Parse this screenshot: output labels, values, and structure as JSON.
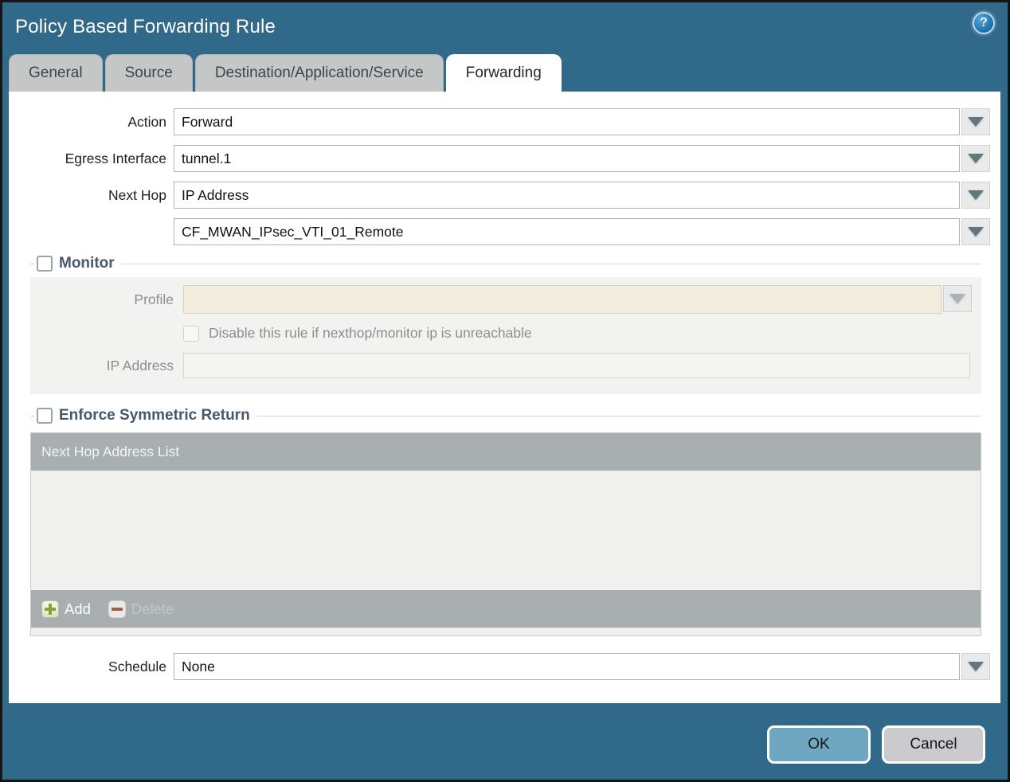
{
  "dialog": {
    "title": "Policy Based Forwarding Rule",
    "help_glyph": "?"
  },
  "tabs": [
    {
      "label": "General",
      "active": false
    },
    {
      "label": "Source",
      "active": false
    },
    {
      "label": "Destination/Application/Service",
      "active": false
    },
    {
      "label": "Forwarding",
      "active": true
    }
  ],
  "form": {
    "action": {
      "label": "Action",
      "value": "Forward"
    },
    "egress_interface": {
      "label": "Egress Interface",
      "value": "tunnel.1"
    },
    "next_hop": {
      "label": "Next Hop",
      "value": "IP Address"
    },
    "next_hop_address": {
      "value": "CF_MWAN_IPsec_VTI_01_Remote"
    },
    "schedule": {
      "label": "Schedule",
      "value": "None"
    }
  },
  "monitor": {
    "legend": "Monitor",
    "checked": false,
    "profile": {
      "label": "Profile",
      "value": ""
    },
    "disable_rule": {
      "label": "Disable this rule if nexthop/monitor ip is unreachable",
      "checked": false
    },
    "ip_address": {
      "label": "IP Address",
      "value": ""
    }
  },
  "symmetric_return": {
    "legend": "Enforce Symmetric Return",
    "checked": false,
    "table": {
      "header": "Next Hop Address List",
      "rows": []
    },
    "add_label": "Add",
    "delete_label": "Delete"
  },
  "footer": {
    "ok_label": "OK",
    "cancel_label": "Cancel"
  },
  "colors": {
    "titlebar_teal": "#31698b",
    "tab_inactive_gray": "#c5c7c7",
    "ok_button_blue": "#6fa7c0",
    "cancel_button_gray": "#cbcbce",
    "profile_field_beige": "#f1ecdc",
    "table_bar_gray": "#a9aeb1",
    "add_icon_green": "#87a23a",
    "delete_icon_red": "#a25d4c",
    "legend_slate": "#47586a"
  }
}
